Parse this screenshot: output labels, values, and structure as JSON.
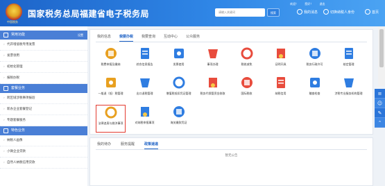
{
  "header": {
    "title": "国家税务总局福建省电子税务局",
    "emblem_text": "中国税务",
    "search_placeholder": "请输入关键词",
    "search_button": "搜索",
    "top_links": [
      "欢迎！",
      "您好！",
      "退出"
    ],
    "nav": [
      {
        "label": "我的消息",
        "icon": "bell-icon"
      },
      {
        "label": "切换纳税人身份",
        "icon": "switch-icon"
      },
      {
        "label": "首页",
        "icon": "home-icon"
      }
    ]
  },
  "sidebar": {
    "sections": [
      {
        "title": "常用功能",
        "more": "设置",
        "icon": "star-icon",
        "items": [
          "代开增值税专用发票",
          "发票领用",
          "初始化管理",
          "报税办税"
        ]
      },
      {
        "title": "套餐业务",
        "icon": "package-icon",
        "items": [
          "跨区域涉税事项报验",
          "新办企业套餐登记",
          "专题套餐服务"
        ]
      },
      {
        "title": "特色业务",
        "icon": "feature-icon",
        "items": [
          "纳税人画像",
          "小微企业贷款",
          "自然人纳税信用贷款"
        ]
      }
    ]
  },
  "main": {
    "tabs": [
      "我的信息",
      "我要办税",
      "我要查询",
      "互动中心",
      "公众服务"
    ],
    "active_tab": 1,
    "tiles": [
      {
        "label": "税费申报及缴纳",
        "icon": "tax-declare-icon",
        "color": "#e8a020"
      },
      {
        "label": "综合信息报告",
        "icon": "report-icon",
        "color": "#2f7de1"
      },
      {
        "label": "发票使用",
        "icon": "invoice-icon",
        "color": "#2f7de1"
      },
      {
        "label": "事项办理",
        "icon": "matter-icon",
        "color": "#e84c3d"
      },
      {
        "label": "税收减免",
        "icon": "reduction-icon",
        "color": "#e84c3d"
      },
      {
        "label": "证明开具",
        "icon": "certificate-icon",
        "color": "#e84c3d"
      },
      {
        "label": "税务行政许可",
        "icon": "license-icon",
        "color": "#2f7de1"
      },
      {
        "label": "核定管理",
        "icon": "verify-icon",
        "color": "#2f7de1"
      },
      {
        "label": "一般退（抵）税管理",
        "icon": "refund-icon",
        "color": "#e8a020"
      },
      {
        "label": "出口退税管理",
        "icon": "export-refund-icon",
        "color": "#2f7de1"
      },
      {
        "label": "增值税抵扣凭证管理",
        "icon": "deduction-icon",
        "color": "#2f7de1"
      },
      {
        "label": "税务代保管资金收取",
        "icon": "custody-icon",
        "color": "#e84c3d"
      },
      {
        "label": "国际税收",
        "icon": "globe-icon",
        "color": "#e84c3d"
      },
      {
        "label": "纳税信用",
        "icon": "credit-icon",
        "color": "#e84c3d"
      },
      {
        "label": "稽查检查",
        "icon": "inspection-icon",
        "color": "#2f7de1"
      },
      {
        "label": "涉税专业服务机构管理",
        "icon": "agency-icon",
        "color": "#2f7de1"
      },
      {
        "label": "法律追责与救济事项",
        "icon": "gavel-icon",
        "color": "#e8a020"
      },
      {
        "label": "对纳税申报事项",
        "icon": "doc-icon",
        "color": "#2f7de1"
      },
      {
        "label": "海关缴款凭证",
        "icon": "customs-icon",
        "color": "#2f7de1"
      }
    ],
    "highlighted_tile": 16,
    "bottom_tabs": [
      "我的待办",
      "服务提醒",
      "政策速递"
    ],
    "bottom_active_tab": 2,
    "notice": "暂无公告"
  },
  "floatbar": [
    "≡",
    "☺",
    "✎",
    "⌃"
  ],
  "colors": {
    "header_blue": "#1d64c9",
    "accent": "#1a5fc4",
    "highlight": "#e33a2f"
  }
}
